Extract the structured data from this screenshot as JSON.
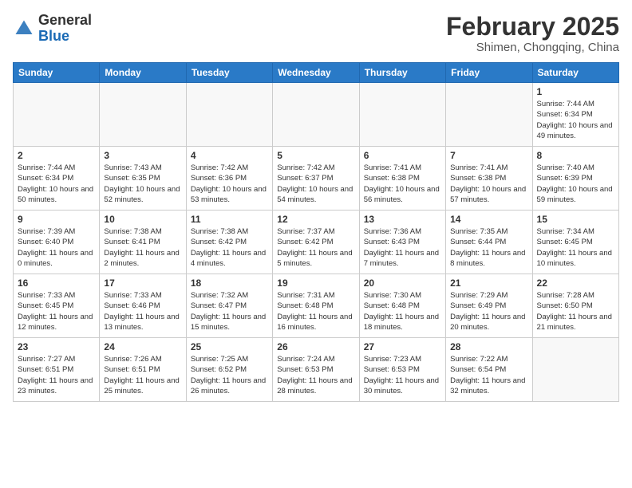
{
  "header": {
    "logo_general": "General",
    "logo_blue": "Blue",
    "month": "February 2025",
    "location": "Shimen, Chongqing, China"
  },
  "weekdays": [
    "Sunday",
    "Monday",
    "Tuesday",
    "Wednesday",
    "Thursday",
    "Friday",
    "Saturday"
  ],
  "weeks": [
    [
      {
        "day": "",
        "info": ""
      },
      {
        "day": "",
        "info": ""
      },
      {
        "day": "",
        "info": ""
      },
      {
        "day": "",
        "info": ""
      },
      {
        "day": "",
        "info": ""
      },
      {
        "day": "",
        "info": ""
      },
      {
        "day": "1",
        "info": "Sunrise: 7:44 AM\nSunset: 6:34 PM\nDaylight: 10 hours and 49 minutes."
      }
    ],
    [
      {
        "day": "2",
        "info": "Sunrise: 7:44 AM\nSunset: 6:34 PM\nDaylight: 10 hours and 50 minutes."
      },
      {
        "day": "3",
        "info": "Sunrise: 7:43 AM\nSunset: 6:35 PM\nDaylight: 10 hours and 52 minutes."
      },
      {
        "day": "4",
        "info": "Sunrise: 7:42 AM\nSunset: 6:36 PM\nDaylight: 10 hours and 53 minutes."
      },
      {
        "day": "5",
        "info": "Sunrise: 7:42 AM\nSunset: 6:37 PM\nDaylight: 10 hours and 54 minutes."
      },
      {
        "day": "6",
        "info": "Sunrise: 7:41 AM\nSunset: 6:38 PM\nDaylight: 10 hours and 56 minutes."
      },
      {
        "day": "7",
        "info": "Sunrise: 7:41 AM\nSunset: 6:38 PM\nDaylight: 10 hours and 57 minutes."
      },
      {
        "day": "8",
        "info": "Sunrise: 7:40 AM\nSunset: 6:39 PM\nDaylight: 10 hours and 59 minutes."
      }
    ],
    [
      {
        "day": "9",
        "info": "Sunrise: 7:39 AM\nSunset: 6:40 PM\nDaylight: 11 hours and 0 minutes."
      },
      {
        "day": "10",
        "info": "Sunrise: 7:38 AM\nSunset: 6:41 PM\nDaylight: 11 hours and 2 minutes."
      },
      {
        "day": "11",
        "info": "Sunrise: 7:38 AM\nSunset: 6:42 PM\nDaylight: 11 hours and 4 minutes."
      },
      {
        "day": "12",
        "info": "Sunrise: 7:37 AM\nSunset: 6:42 PM\nDaylight: 11 hours and 5 minutes."
      },
      {
        "day": "13",
        "info": "Sunrise: 7:36 AM\nSunset: 6:43 PM\nDaylight: 11 hours and 7 minutes."
      },
      {
        "day": "14",
        "info": "Sunrise: 7:35 AM\nSunset: 6:44 PM\nDaylight: 11 hours and 8 minutes."
      },
      {
        "day": "15",
        "info": "Sunrise: 7:34 AM\nSunset: 6:45 PM\nDaylight: 11 hours and 10 minutes."
      }
    ],
    [
      {
        "day": "16",
        "info": "Sunrise: 7:33 AM\nSunset: 6:45 PM\nDaylight: 11 hours and 12 minutes."
      },
      {
        "day": "17",
        "info": "Sunrise: 7:33 AM\nSunset: 6:46 PM\nDaylight: 11 hours and 13 minutes."
      },
      {
        "day": "18",
        "info": "Sunrise: 7:32 AM\nSunset: 6:47 PM\nDaylight: 11 hours and 15 minutes."
      },
      {
        "day": "19",
        "info": "Sunrise: 7:31 AM\nSunset: 6:48 PM\nDaylight: 11 hours and 16 minutes."
      },
      {
        "day": "20",
        "info": "Sunrise: 7:30 AM\nSunset: 6:48 PM\nDaylight: 11 hours and 18 minutes."
      },
      {
        "day": "21",
        "info": "Sunrise: 7:29 AM\nSunset: 6:49 PM\nDaylight: 11 hours and 20 minutes."
      },
      {
        "day": "22",
        "info": "Sunrise: 7:28 AM\nSunset: 6:50 PM\nDaylight: 11 hours and 21 minutes."
      }
    ],
    [
      {
        "day": "23",
        "info": "Sunrise: 7:27 AM\nSunset: 6:51 PM\nDaylight: 11 hours and 23 minutes."
      },
      {
        "day": "24",
        "info": "Sunrise: 7:26 AM\nSunset: 6:51 PM\nDaylight: 11 hours and 25 minutes."
      },
      {
        "day": "25",
        "info": "Sunrise: 7:25 AM\nSunset: 6:52 PM\nDaylight: 11 hours and 26 minutes."
      },
      {
        "day": "26",
        "info": "Sunrise: 7:24 AM\nSunset: 6:53 PM\nDaylight: 11 hours and 28 minutes."
      },
      {
        "day": "27",
        "info": "Sunrise: 7:23 AM\nSunset: 6:53 PM\nDaylight: 11 hours and 30 minutes."
      },
      {
        "day": "28",
        "info": "Sunrise: 7:22 AM\nSunset: 6:54 PM\nDaylight: 11 hours and 32 minutes."
      },
      {
        "day": "",
        "info": ""
      }
    ]
  ]
}
